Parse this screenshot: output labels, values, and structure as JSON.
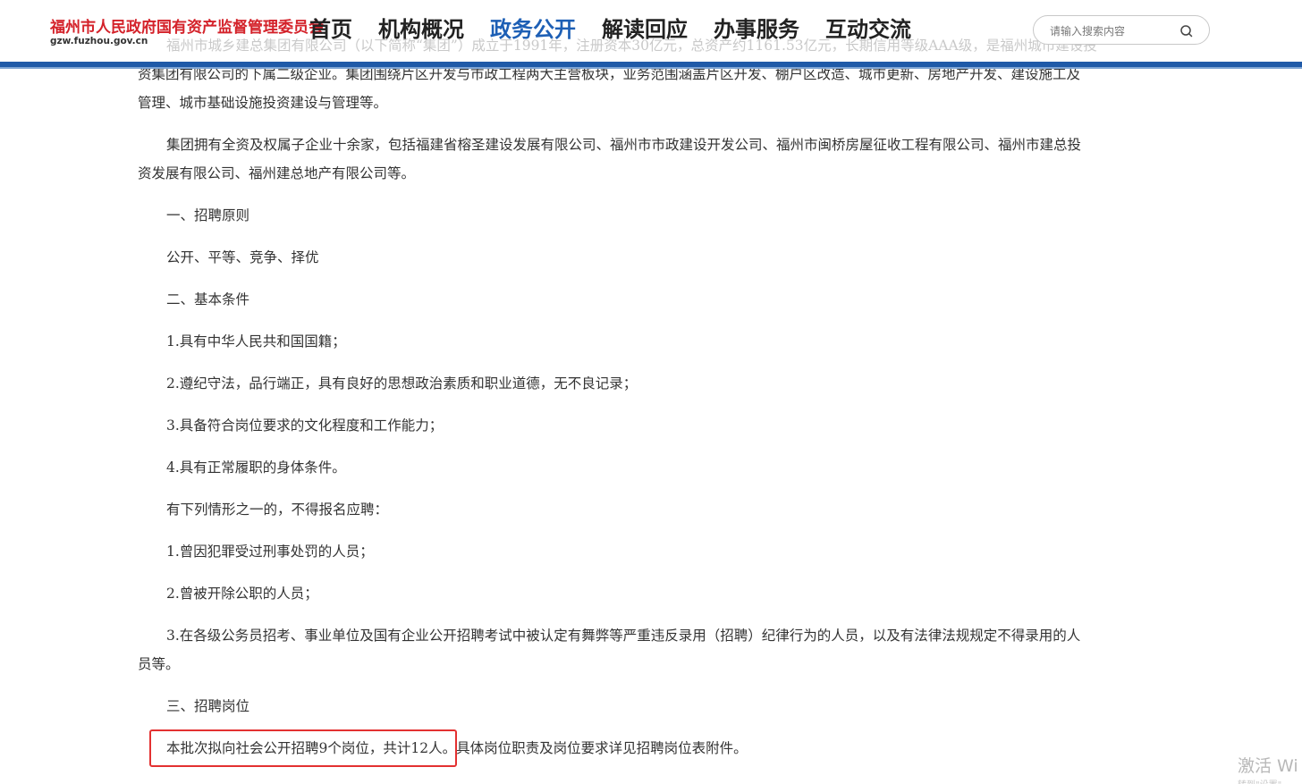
{
  "header": {
    "site_title": "福州市人民政府国有资产监督管理委员会",
    "site_url": "gzw.fuzhou.gov.cn",
    "nav": [
      {
        "label": "首页",
        "active": false
      },
      {
        "label": "机构概况",
        "active": false
      },
      {
        "label": "政务公开",
        "active": true
      },
      {
        "label": "解读回应",
        "active": false
      },
      {
        "label": "办事服务",
        "active": false
      },
      {
        "label": "互动交流",
        "active": false
      }
    ],
    "search_placeholder": "请输入搜索内容",
    "search_icon": "search-icon",
    "accent_color": "#1f5aa8"
  },
  "article": {
    "intro_partial": "福州市城乡建总集团有限公司（以下简称“集团”）成立于1991年，注册资本30亿元，总资产约1161.53亿元，长期信用等级AAA级，是福州城市建设投",
    "intro_cont_1": "资集团有限公司的下属二级企业。集团围绕片区开发与市政工程两大主营板块，业务范围涵盖片区开发、棚户区改造、城市更新、房地产开发、建设施工及",
    "intro_cont_2": "管理、城市基础设施投资建设与管理等。",
    "para2_line1": "集团拥有全资及权属子企业十余家，包括福建省榕圣建设发展有限公司、福州市市政建设开发公司、福州市闽桥房屋征收工程有限公司、福州市建总投",
    "para2_line2": "资发展有限公司、福州建总地产有限公司等。",
    "section1_title": "一、招聘原则",
    "section1_text": "公开、平等、竞争、择优",
    "section2_title": "二、基本条件",
    "cond1": "1.具有中华人民共和国国籍；",
    "cond2": "2.遵纪守法，品行端正，具有良好的思想政治素质和职业道德，无不良记录；",
    "cond3": "3.具备符合岗位要求的文化程度和工作能力；",
    "cond4": "4.具有正常履职的身体条件。",
    "exclusion_intro": "有下列情形之一的，不得报名应聘：",
    "excl1": "1.曾因犯罪受过刑事处罚的人员；",
    "excl2": "2.曾被开除公职的人员；",
    "excl3_line1": "3.在各级公务员招考、事业单位及国有企业公开招聘考试中被认定有舞弊等严重违反录用（招聘）纪律行为的人员，以及有法律法规规定不得录用的人",
    "excl3_line2": "员等。",
    "section3_title": "三、招聘岗位",
    "positions_highlight": "本批次拟向社会公开招聘9个岗位，共计12人。",
    "positions_rest": "具体岗位职责及岗位要求详见招聘岗位表附件。",
    "highlight_color": "#e33131"
  },
  "os_watermark": {
    "line1": "激活 Wi",
    "line2": "转到\"设置\""
  }
}
